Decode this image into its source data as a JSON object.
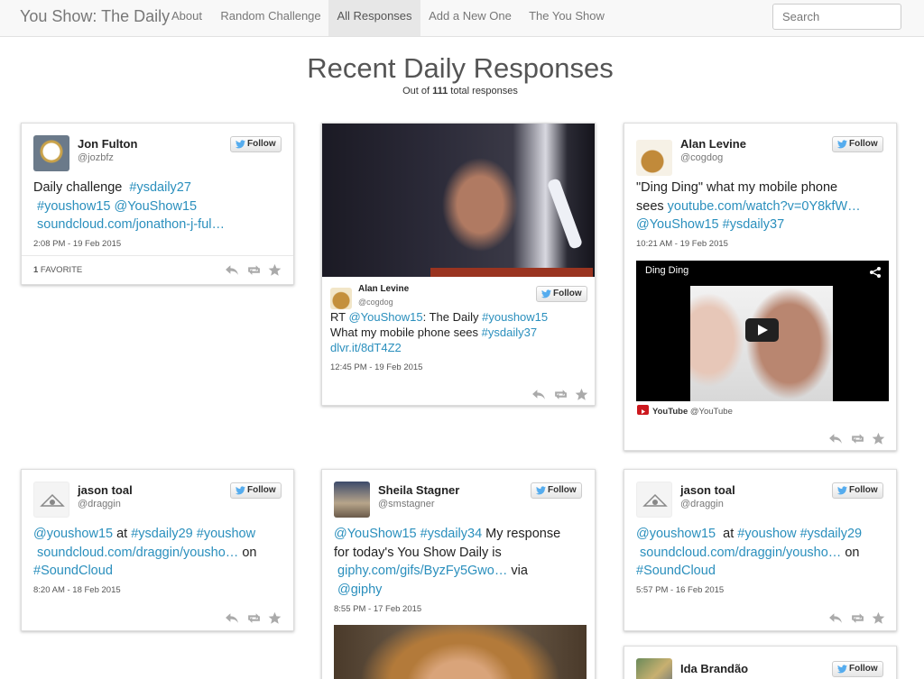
{
  "nav": {
    "brand": "You Show: The Daily",
    "items": [
      {
        "label": "About",
        "active": false
      },
      {
        "label": "Random Challenge",
        "active": false
      },
      {
        "label": "All Responses",
        "active": true
      },
      {
        "label": "Add a New One",
        "active": false
      },
      {
        "label": "The You Show",
        "active": false
      }
    ],
    "search_placeholder": "Search"
  },
  "header": {
    "title": "Recent Daily Responses",
    "subtitle_prefix": "Out of ",
    "total": "111",
    "subtitle_suffix": " total responses"
  },
  "follow_label": "Follow",
  "cards": [
    {
      "name": "Jon Fulton",
      "handle": "@jozbfz",
      "text": [
        [
          {
            "t": "Daily challenge  "
          },
          {
            "t": "#ysdaily27",
            "link": true
          }
        ],
        [
          {
            "t": " #youshow15",
            "link": true
          },
          {
            "t": " "
          },
          {
            "t": "@YouShow15",
            "link": true
          }
        ],
        [
          {
            "t": " soundcloud.com/jonathon-j-ful…",
            "link": true
          }
        ]
      ],
      "time": "2:08 PM - 19 Feb 2015",
      "favorites_count": "1",
      "favorites_label": " FAVORITE"
    },
    {
      "name": "Alan Levine",
      "handle": "@cogdog",
      "text": [
        [
          {
            "t": "RT "
          },
          {
            "t": "@YouShow15",
            "link": true
          },
          {
            "t": ": The Daily "
          },
          {
            "t": "#youshow15",
            "link": true
          }
        ],
        [
          {
            "t": "What my mobile phone sees "
          },
          {
            "t": "#ysdaily37",
            "link": true
          }
        ],
        [
          {
            "t": "dlvr.it/8dT4Z2",
            "link": true
          }
        ]
      ],
      "time": "12:45 PM - 19 Feb 2015"
    },
    {
      "name": "Alan Levine",
      "handle": "@cogdog",
      "text": [
        [
          {
            "t": "\"Ding Ding\" what my mobile phone"
          }
        ],
        [
          {
            "t": "sees "
          },
          {
            "t": "youtube.com/watch?v=0Y8kfW…",
            "link": true
          }
        ],
        [
          {
            "t": "@YouShow15",
            "link": true
          },
          {
            "t": " "
          },
          {
            "t": "#ysdaily37",
            "link": true
          }
        ]
      ],
      "time": "10:21 AM - 19 Feb 2015",
      "video_title": "Ding Ding",
      "source_name": "YouTube",
      "source_handle": " @YouTube"
    },
    {
      "name": "jason toal",
      "handle": "@draggin",
      "text": [
        [
          {
            "t": "@youshow15",
            "link": true
          },
          {
            "t": " at "
          },
          {
            "t": "#ysdaily29",
            "link": true
          },
          {
            "t": " "
          },
          {
            "t": "#youshow",
            "link": true
          }
        ],
        [
          {
            "t": " soundcloud.com/draggin/yousho…",
            "link": true
          },
          {
            "t": " on"
          }
        ],
        [
          {
            "t": "#SoundCloud",
            "link": true
          }
        ]
      ],
      "time": "8:20 AM - 18 Feb 2015"
    },
    {
      "name": "Sheila Stagner",
      "handle": "@smstagner",
      "text": [
        [
          {
            "t": "@YouShow15",
            "link": true
          },
          {
            "t": " "
          },
          {
            "t": "#ysdaily34",
            "link": true
          },
          {
            "t": " My response"
          }
        ],
        [
          {
            "t": "for today's You Show Daily is"
          }
        ],
        [
          {
            "t": " giphy.com/gifs/ByzFy5Gwo…",
            "link": true
          },
          {
            "t": " via"
          }
        ],
        [
          {
            "t": " @giphy",
            "link": true
          }
        ]
      ],
      "time": "8:55 PM - 17 Feb 2015"
    },
    {
      "name": "jason toal",
      "handle": "@draggin",
      "text": [
        [
          {
            "t": "@youshow15",
            "link": true
          },
          {
            "t": "  at "
          },
          {
            "t": "#youshow",
            "link": true
          },
          {
            "t": " "
          },
          {
            "t": "#ysdaily29",
            "link": true
          }
        ],
        [
          {
            "t": " soundcloud.com/draggin/yousho…",
            "link": true
          },
          {
            "t": " on"
          }
        ],
        [
          {
            "t": "#SoundCloud",
            "link": true
          }
        ]
      ],
      "time": "5:57 PM - 16 Feb 2015"
    },
    {
      "name": "Ida Brandão",
      "handle": ""
    }
  ],
  "colors": {
    "link": "#2a8fbd",
    "nav_bg": "#f8f8f8",
    "nav_active_bg": "#e7e7e7",
    "twitter_blue": "#55acee",
    "youtube_red": "#cc181e"
  }
}
